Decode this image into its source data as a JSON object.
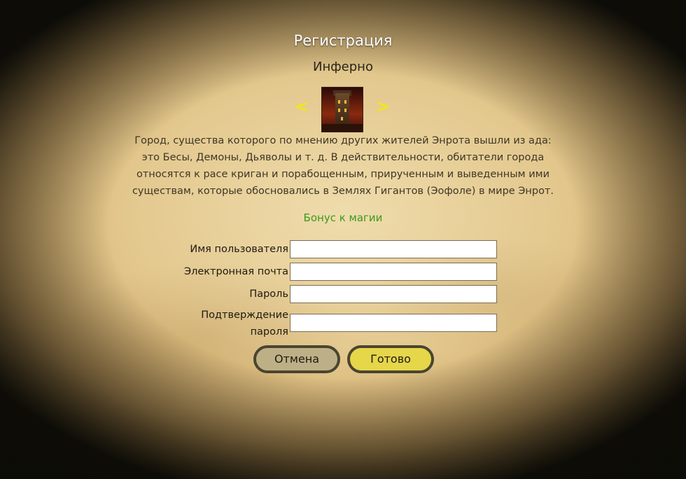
{
  "dialog": {
    "title": "Регистрация",
    "faction_name": "Инферно",
    "prev_arrow": "<",
    "next_arrow": ">",
    "portrait_icon": "inferno-castle-icon",
    "description": "Город, существа которого по мнению других жителей Энрота вышли из ада: это Бесы, Демоны, Дьяволы и т. д. В действительности, обитатели города относятся к расе криган и порабощенным, прирученным и выведенным ими существам, которые обосновались в Землях Гигантов (Эофоле) в мире Энрот.",
    "bonus": "Бонус к магии"
  },
  "form": {
    "username_label": "Имя пользователя",
    "username_value": "",
    "email_label": "Электронная почта",
    "email_value": "",
    "password_label": "Пароль",
    "password_value": "",
    "confirm_label_line1": "Подтверждение",
    "confirm_label_line2": "пароля",
    "confirm_value": ""
  },
  "buttons": {
    "cancel": "Отмена",
    "ok": "Готово"
  },
  "colors": {
    "title": "#ffffff",
    "bonus": "#3d9a1e",
    "arrows": "#f2e61a",
    "ok_button": "#e6d64a",
    "cancel_button": "#beb086"
  }
}
